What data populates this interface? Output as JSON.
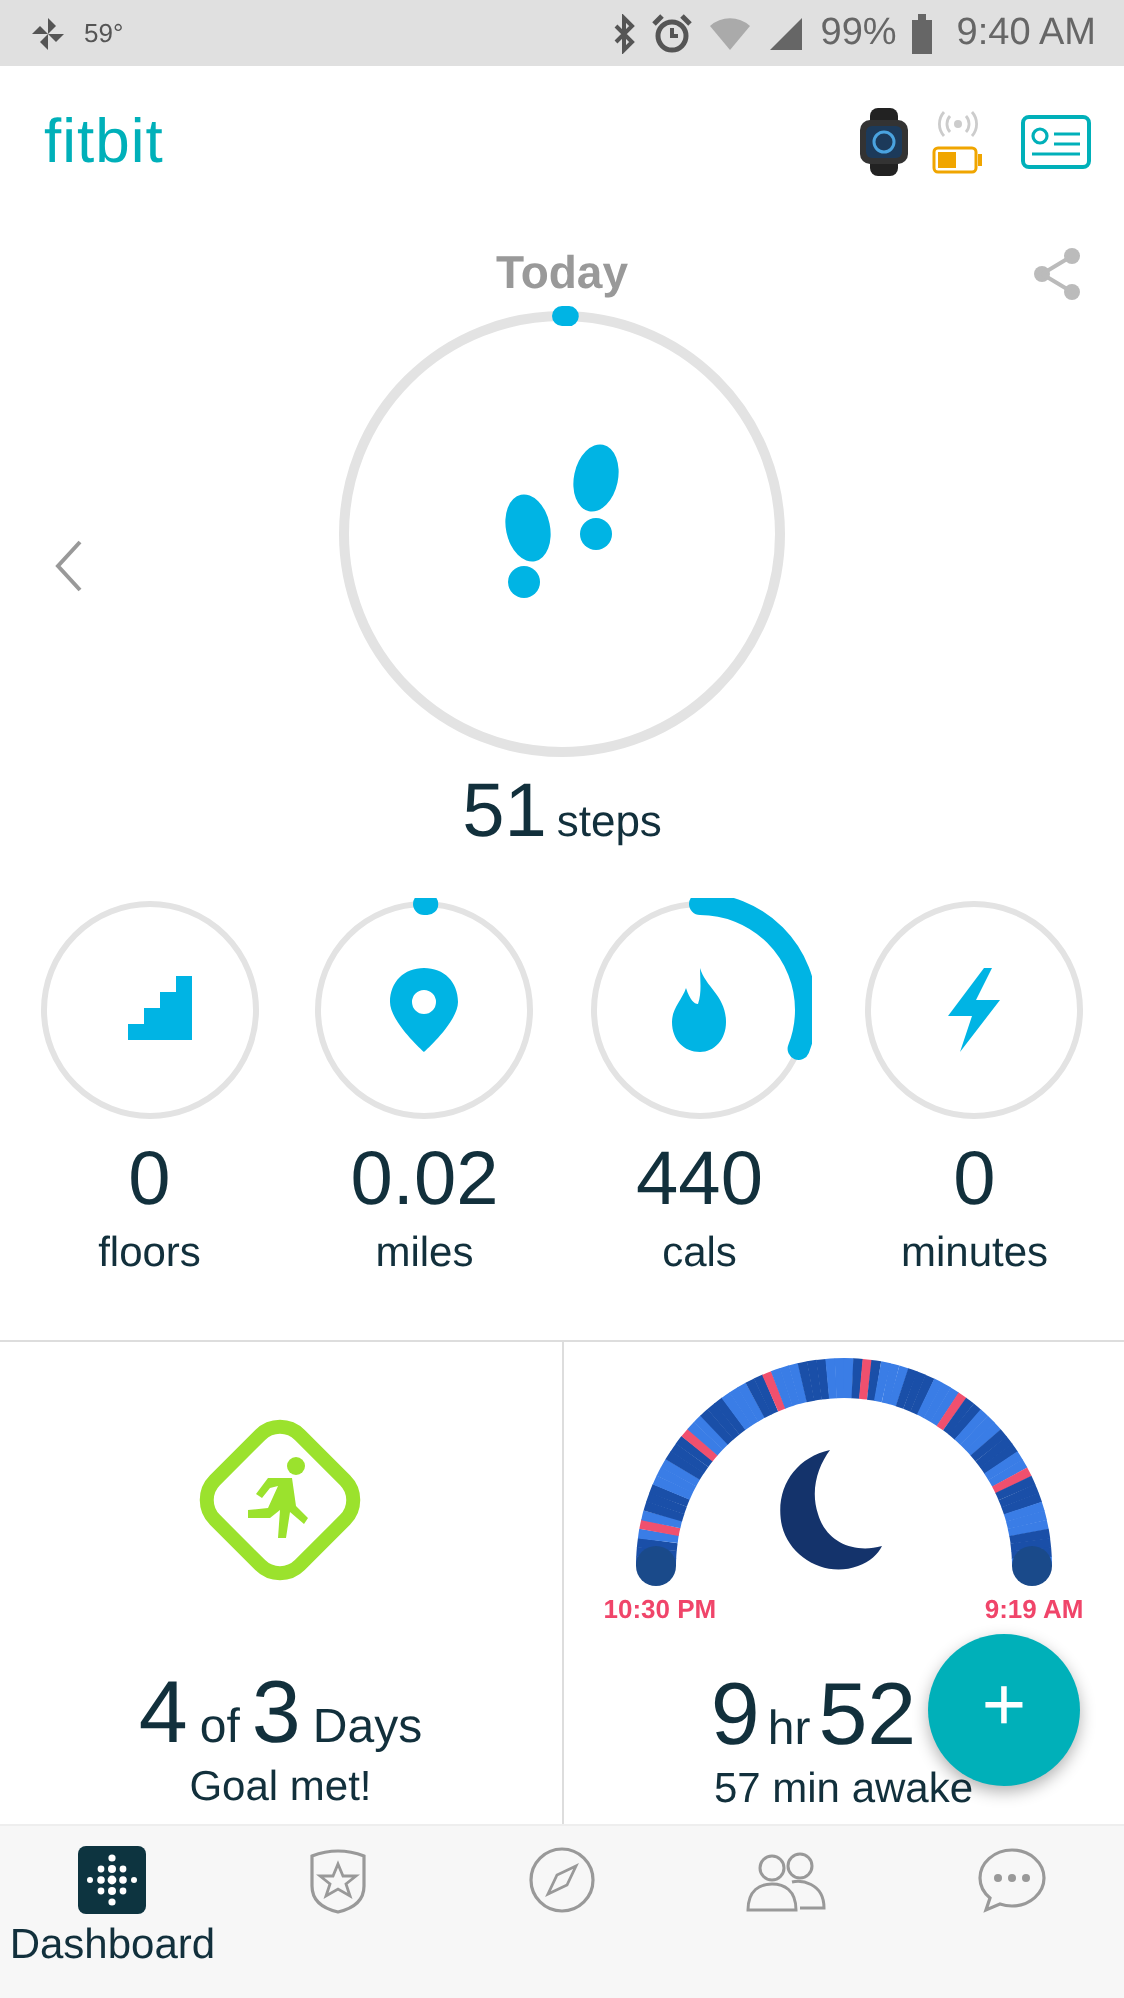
{
  "status_bar": {
    "temperature": "59°",
    "battery": "99%",
    "time": "9:40 AM"
  },
  "header": {
    "logo": "fitbit"
  },
  "today": {
    "title": "Today",
    "steps": {
      "value": "51",
      "unit": "steps",
      "level": 0.005
    }
  },
  "stats": [
    {
      "kind": "floors",
      "value": "0",
      "unit": "floors"
    },
    {
      "kind": "distance",
      "value": "0.02",
      "unit": "miles",
      "level": 0.005
    },
    {
      "kind": "calories",
      "value": "440",
      "unit": "cals",
      "level": 0.31
    },
    {
      "kind": "active",
      "value": "0",
      "unit": "minutes"
    }
  ],
  "tiles": {
    "exercise": {
      "value": "4",
      "of": "of",
      "goal": "3",
      "unit": "Days",
      "caption": "Goal met!"
    },
    "sleep": {
      "start": "10:30 PM",
      "end": "9:19 AM",
      "hours": "9",
      "hours_unit": "hr",
      "minutes": "52",
      "caption": "57 min awake"
    }
  },
  "fab": {
    "label": "+"
  },
  "nav": [
    {
      "kind": "dashboard",
      "label": "Dashboard",
      "selected": true
    },
    {
      "kind": "challenges",
      "selected": false
    },
    {
      "kind": "discover",
      "selected": false
    },
    {
      "kind": "community",
      "selected": false
    },
    {
      "kind": "messages",
      "selected": false
    }
  ]
}
